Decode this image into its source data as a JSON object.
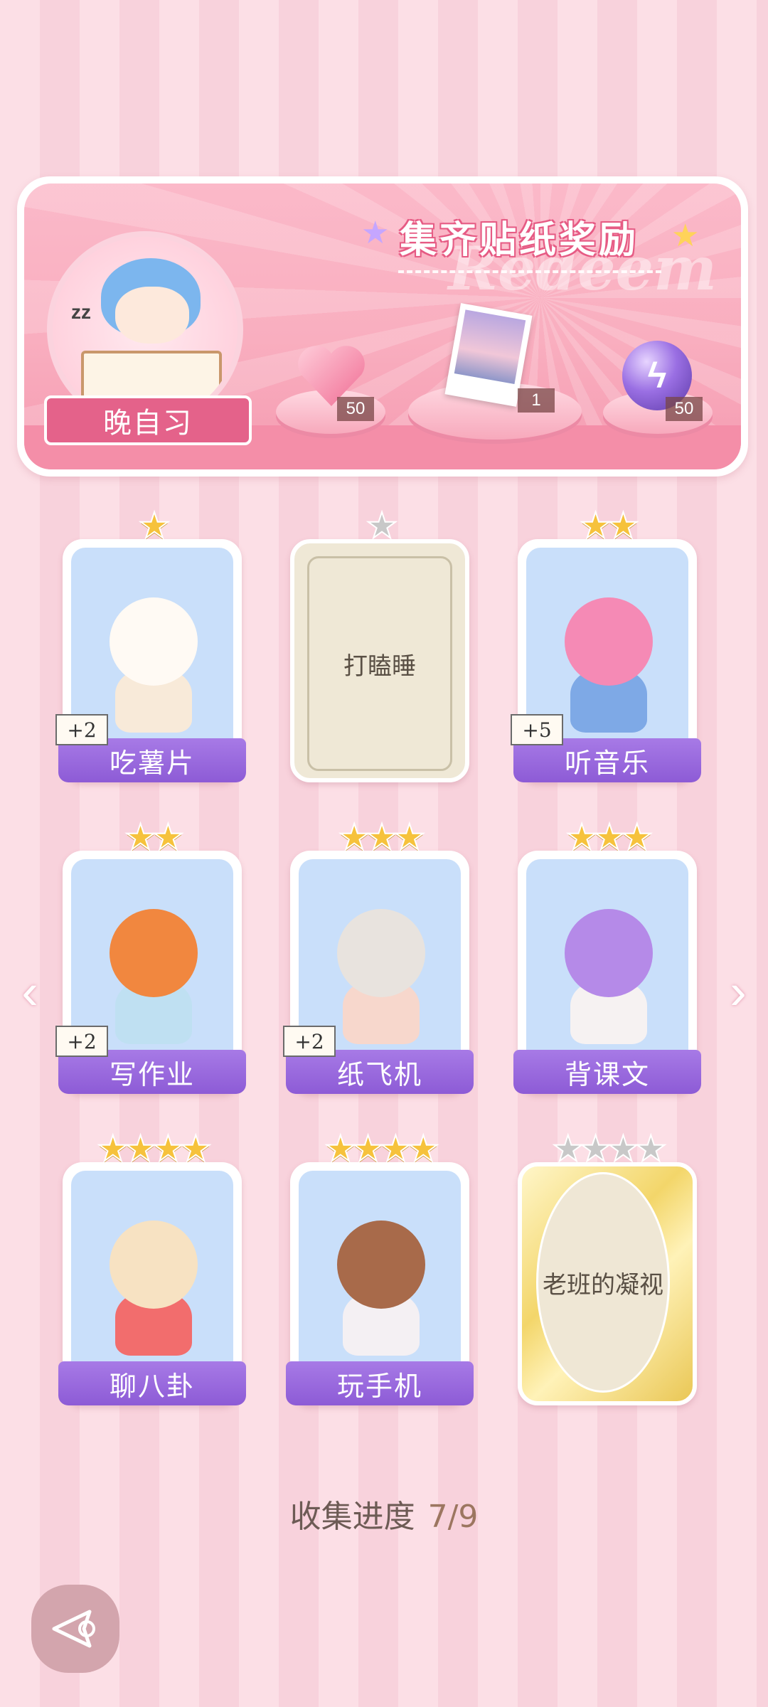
{
  "banner": {
    "title": "集齐贴纸奖励",
    "watermark": "Redeem",
    "chapter_label": "晚自习",
    "rewards": [
      {
        "icon": "heart-gem-icon",
        "count": "50"
      },
      {
        "icon": "photo-card-icon",
        "count": "1"
      },
      {
        "icon": "energy-orb-icon",
        "count": "50"
      }
    ]
  },
  "cards": [
    {
      "label": "吃薯片",
      "stars": 1,
      "collected": true,
      "bonus": "+2",
      "art": "fox-eating-chips"
    },
    {
      "label": "打瞌睡",
      "stars": 1,
      "collected": false,
      "bonus": "",
      "art": ""
    },
    {
      "label": "听音乐",
      "stars": 2,
      "collected": true,
      "bonus": "+5",
      "art": "girl-headphones"
    },
    {
      "label": "写作业",
      "stars": 2,
      "collected": true,
      "bonus": "+2",
      "art": "boy-homework"
    },
    {
      "label": "纸飞机",
      "stars": 3,
      "collected": true,
      "bonus": "+2",
      "art": "cat-paper-plane"
    },
    {
      "label": "背课文",
      "stars": 3,
      "collected": true,
      "bonus": "",
      "art": "girl-reading"
    },
    {
      "label": "聊八卦",
      "stars": 4,
      "collected": true,
      "bonus": "",
      "art": "puppy-watermelon"
    },
    {
      "label": "玩手机",
      "stars": 4,
      "collected": true,
      "bonus": "",
      "art": "girl-phone"
    },
    {
      "label": "老班的凝视",
      "stars": 4,
      "collected": false,
      "bonus": "",
      "art": ""
    }
  ],
  "progress": {
    "label": "收集进度",
    "value": "7/9"
  },
  "colors": {
    "label_purple": "#9466dc",
    "banner_pink": "#f9aebf",
    "star_gold": "#f6c23c"
  }
}
